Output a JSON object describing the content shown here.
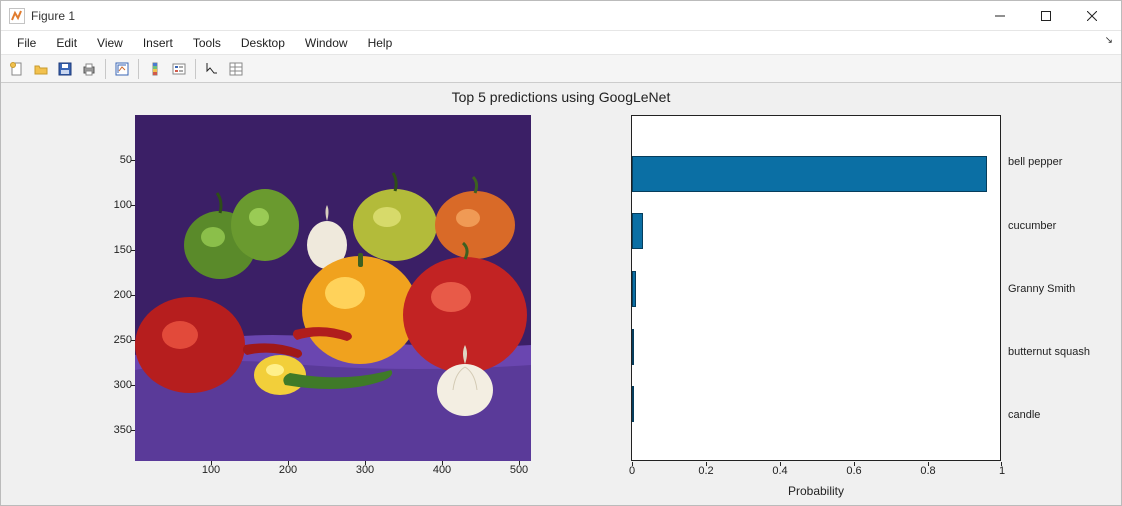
{
  "window": {
    "title": "Figure 1"
  },
  "menu": {
    "file": "File",
    "edit": "Edit",
    "view": "View",
    "insert": "Insert",
    "tools": "Tools",
    "desktop": "Desktop",
    "window": "Window",
    "help": "Help"
  },
  "figure": {
    "title": "Top 5 predictions using GoogLeNet",
    "left_axes": {
      "xticks": [
        "100",
        "200",
        "300",
        "400",
        "500"
      ],
      "yticks": [
        "50",
        "100",
        "150",
        "200",
        "250",
        "300",
        "350"
      ]
    },
    "right_axes": {
      "xlabel": "Probability",
      "xticks": [
        "0",
        "0.2",
        "0.4",
        "0.6",
        "0.8",
        "1"
      ]
    }
  },
  "chart_data": {
    "type": "bar",
    "orientation": "horizontal",
    "title": "Top 5 predictions using GoogLeNet",
    "xlabel": "Probability",
    "ylabel": "",
    "xlim": [
      0,
      1
    ],
    "categories": [
      "bell pepper",
      "cucumber",
      "Granny Smith",
      "butternut squash",
      "candle"
    ],
    "values": [
      0.96,
      0.03,
      0.01,
      0.003,
      0.001
    ]
  },
  "colors": {
    "bar_fill": "#0b6fa4",
    "bar_edge": "#063d5c",
    "axes_bg": "#ffffff",
    "figure_bg": "#f0f0f0"
  }
}
